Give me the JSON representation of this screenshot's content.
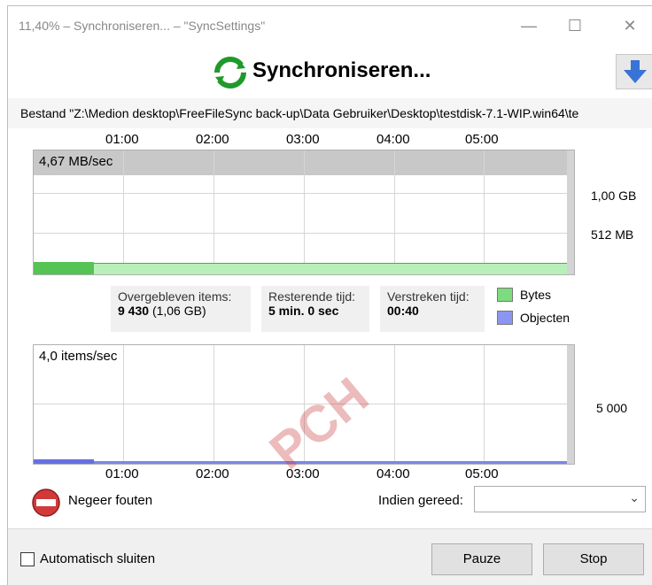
{
  "window": {
    "title": "11,40% – Synchroniseren... – \"SyncSettings\"",
    "minimize": "—",
    "maximize": "☐",
    "close": "✕"
  },
  "header": {
    "title": "Synchroniseren...",
    "down_arrow_icon": "arrow-down-icon"
  },
  "file_path": "Bestand \"Z:\\Medion desktop\\FreeFileSync back-up\\Data Gebruiker\\Desktop\\testdisk-7.1-WIP.win64\\te",
  "top_axis": [
    "01:00",
    "02:00",
    "03:00",
    "04:00",
    "05:00"
  ],
  "bottom_axis": [
    "01:00",
    "02:00",
    "03:00",
    "04:00",
    "05:00"
  ],
  "bytes_graph": {
    "rate": "4,67 MB/sec",
    "y_labels": [
      "1,00 GB",
      "512 MB"
    ],
    "progress": 0.114
  },
  "items_graph": {
    "rate": "4,0 items/sec",
    "y_labels": [
      "5 000"
    ]
  },
  "stats": {
    "remaining_items_label": "Overgebleven items:",
    "remaining_items_value": "9 430",
    "remaining_items_size": "(1,06 GB)",
    "remaining_time_label": "Resterende tijd:",
    "remaining_time_value": "5 min. 0 sec",
    "elapsed_time_label": "Verstreken tijd:",
    "elapsed_time_value": "00:40"
  },
  "legend": {
    "bytes": "Bytes",
    "objects": "Objecten",
    "bytes_color": "#7ddc7d",
    "objects_color": "#8c96f0"
  },
  "ignore_errors": "Negeer fouten",
  "when_done_label": "Indien gereed:",
  "when_done_value": "",
  "auto_close": "Automatisch sluiten",
  "buttons": {
    "pause": "Pauze",
    "stop": "Stop"
  },
  "watermark": "PCH"
}
